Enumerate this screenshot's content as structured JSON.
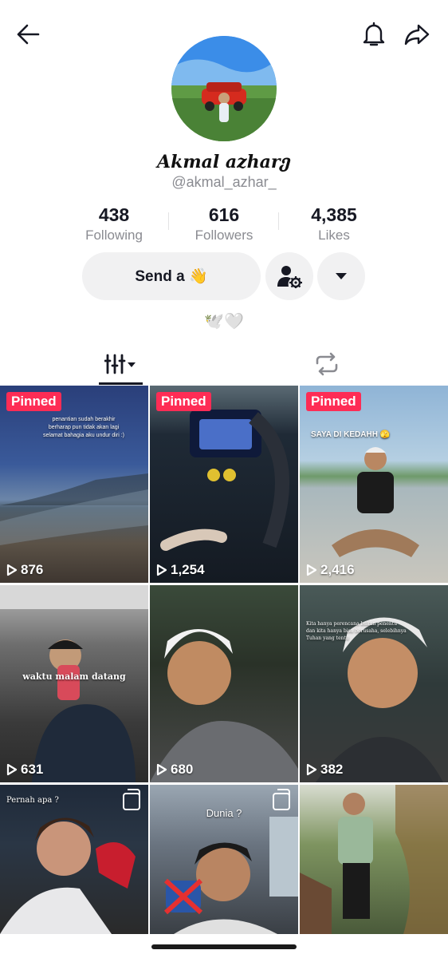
{
  "profile": {
    "display_name": "Akmal azhar",
    "display_name_flourish": "ე",
    "username": "@akmal_azhar_",
    "bio": "🕊️🤍"
  },
  "stats": [
    {
      "value": "438",
      "label": "Following"
    },
    {
      "value": "616",
      "label": "Followers"
    },
    {
      "value": "4,385",
      "label": "Likes"
    }
  ],
  "actions": {
    "send_label": "Send a 👋"
  },
  "icons": {
    "back": "back-arrow-icon",
    "bell": "bell-icon",
    "share": "share-icon",
    "add_friend": "person-gear-icon",
    "dropdown": "caret-down-icon",
    "videos_tab": "grid-bars-icon",
    "reposts_tab": "repost-icon",
    "play": "play-icon",
    "multi_photo": "photo-stack-icon"
  },
  "colors": {
    "pinned_badge": "#fe2c55",
    "text_primary": "#161823",
    "text_secondary": "#8a8b91",
    "button_bg": "#f1f1f2"
  },
  "videos": [
    {
      "pinned_label": "Pinned",
      "views": "876",
      "caption": "penantian sudah berakhir\nberharap pun tidak akan lagi\nselamat bahagia aku undur diri :)"
    },
    {
      "pinned_label": "Pinned",
      "views": "1,254",
      "caption": ""
    },
    {
      "pinned_label": "Pinned",
      "views": "2,416",
      "caption": "SAYA DI KEDAHH 🫣"
    },
    {
      "pinned_label": "",
      "views": "631",
      "caption": "waktu malam datang"
    },
    {
      "pinned_label": "",
      "views": "680",
      "caption": ""
    },
    {
      "pinned_label": "",
      "views": "382",
      "caption": "Kita hanya perencana bukan penentu\ndan kita hanya bisa berusaha, selebihnya\nTuhan yang tentu"
    },
    {
      "pinned_label": "",
      "views": "",
      "caption": "Pernah apa ?"
    },
    {
      "pinned_label": "",
      "views": "",
      "caption": "Dunia ?"
    },
    {
      "pinned_label": "",
      "views": "",
      "caption": ""
    }
  ]
}
